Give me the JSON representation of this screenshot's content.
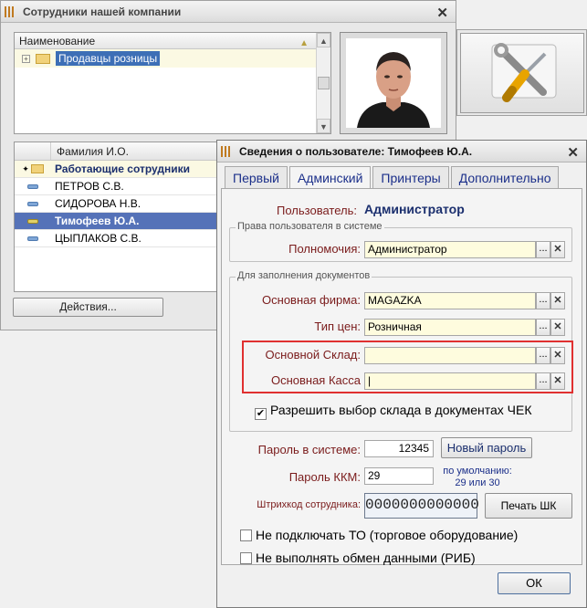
{
  "back_window": {
    "title": "Сотрудники  нашей компании",
    "tree_header": "Наименование",
    "tree_items": [
      {
        "label": "Продавцы розницы"
      }
    ],
    "table_header": "Фамилия И.О.",
    "rows": [
      {
        "name": "Работающие сотрудники",
        "kind": "group"
      },
      {
        "name": "ПЕТРОВ С.В.",
        "kind": "item"
      },
      {
        "name": "СИДОРОВА Н.В.",
        "kind": "item"
      },
      {
        "name": "Тимофеев Ю.А.",
        "kind": "active"
      },
      {
        "name": "ЦЫПЛАКОВ С.В.",
        "kind": "item"
      }
    ],
    "actions_label": "Действия..."
  },
  "dialog": {
    "title": "Сведения о пользователе: Тимофеев Ю.А.",
    "tabs": [
      "Первый",
      "Админский",
      "Принтеры",
      "Дополнительно"
    ],
    "active_tab": "Админский",
    "user_label": "Пользователь:",
    "user_value": "Администратор",
    "rights_group": "Права пользователя в системе",
    "authority_label": "Полномочия:",
    "authority_value": "Администратор",
    "docs_group": "Для заполнения документов",
    "firm_label": "Основная фирма:",
    "firm_value": "MAGAZKA",
    "price_label": "Тип цен:",
    "price_value": "Розничная",
    "warehouse_label": "Основной Склад:",
    "warehouse_value": "",
    "cashbox_label": "Основная Касса",
    "cashbox_value": "|",
    "allow_warehouse_label": "Разрешить выбор склада в документах ЧЕК",
    "allow_warehouse_checked": true,
    "password_label": "Пароль в системе:",
    "password_value": "12345",
    "new_password_label": "Новый пароль",
    "kkm_label": "Пароль ККМ:",
    "kkm_value": "29",
    "default_note_1": "по умолчанию:",
    "default_note_2": "29 или 30",
    "barcode_label": "Штрихкод сотрудника:",
    "barcode_value": "0000000000000",
    "print_barcode_label": "Печать ШК",
    "no_equipment_label": "Не подключать ТО (торговое оборудование)",
    "no_exchange_label": "Не выполнять обмен данными (РИБ)",
    "ok_label": "ОК"
  },
  "icons": {
    "ellipsis": "...",
    "clear": "✕",
    "close": "✕",
    "check": "✔"
  },
  "colors": {
    "highlight_box": "#e03030",
    "selected_row": "#5572b8",
    "field_bg": "#fefcde"
  }
}
